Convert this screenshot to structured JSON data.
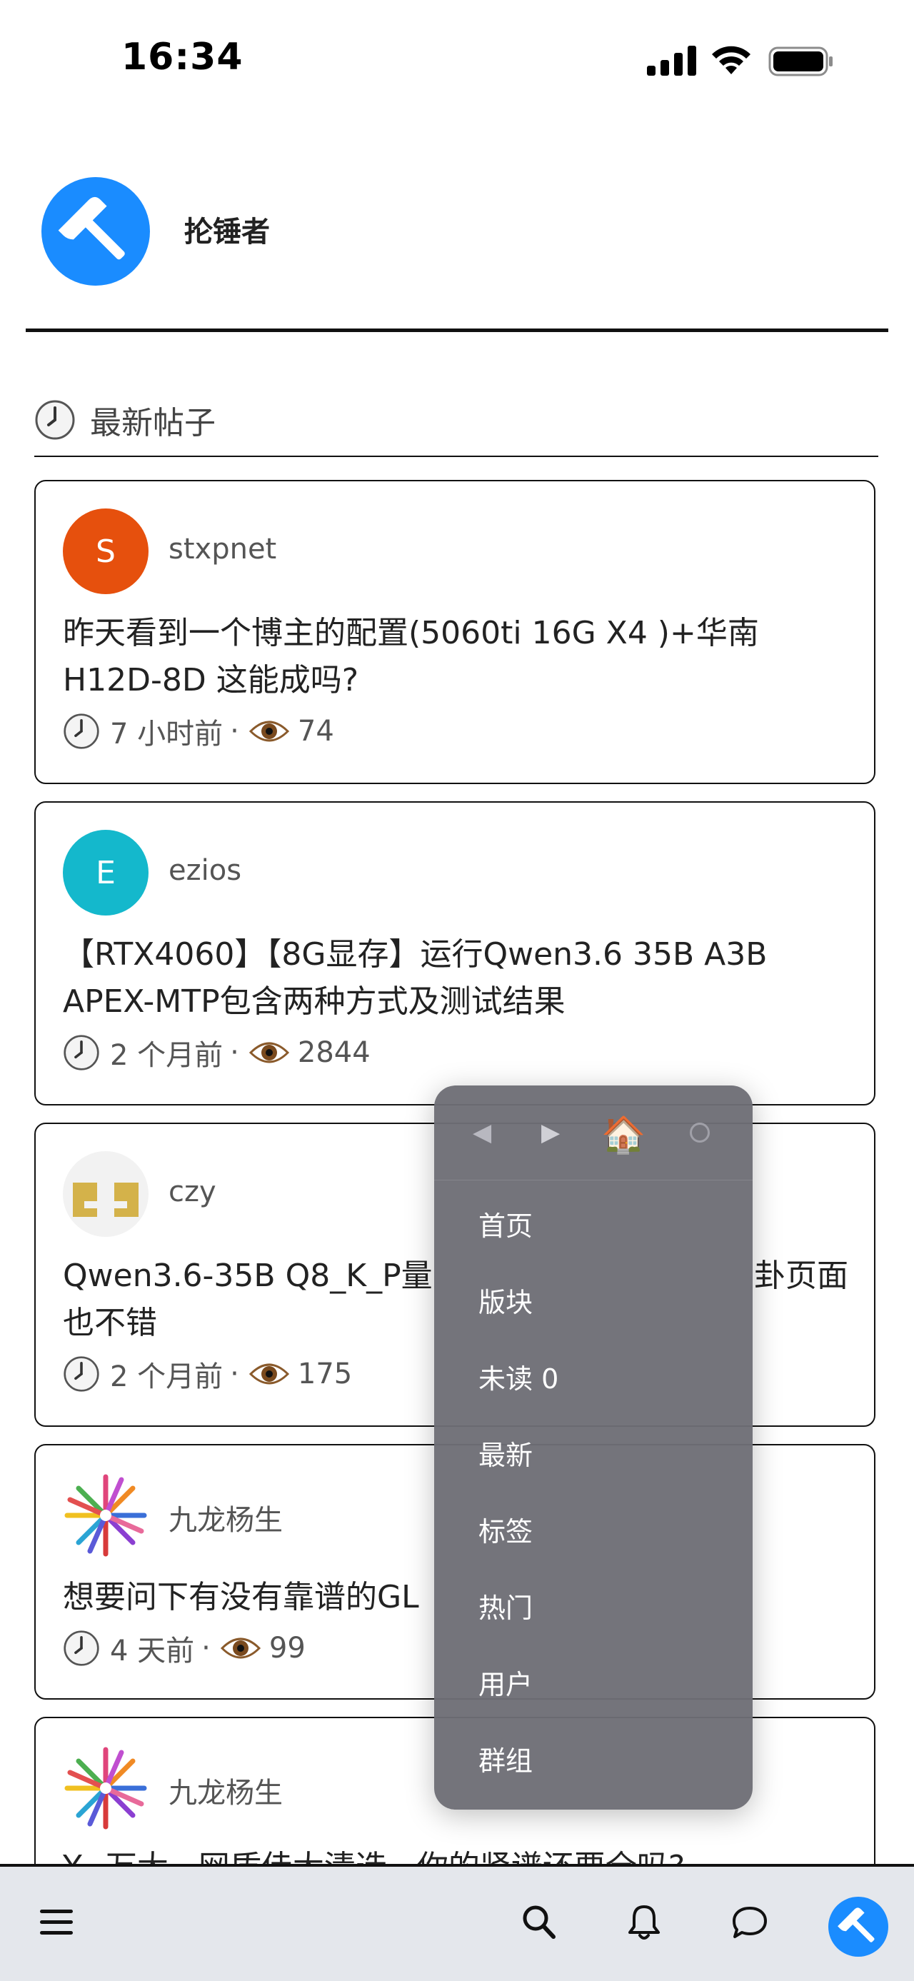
{
  "status_bar": {
    "time": "16:34"
  },
  "header": {
    "site_title": "抡锤者"
  },
  "section": {
    "title": "最新帖子"
  },
  "colors": {
    "brand_blue": "#1a8cff",
    "stxpnet_avatar": "#e6500d",
    "ezios_avatar": "#14b8cc"
  },
  "topics": [
    {
      "username": "stxpnet",
      "avatar_letter": "S",
      "title": "昨天看到一个博主的配置(5060ti 16G X4 )+华南H12D-8D 这能成吗?",
      "age": "7 小时前",
      "views": "74"
    },
    {
      "username": "ezios",
      "avatar_letter": "E",
      "title": "【RTX4060】【8G显存】运行Qwen3.6 35B A3B APEX-MTP包含两种方式及测试结果",
      "age": "2 个月前",
      "views": "2844"
    },
    {
      "username": "czy",
      "title_left": "Qwen3.6-35B Q8_K_P量",
      "title_right": "卦页面",
      "title_line2": "也不错",
      "age": "2 个月前",
      "views": "175"
    },
    {
      "username": "九龙杨生",
      "title_left": "想要问下有没有靠谱的GL",
      "age": "4 天前",
      "views": "99"
    },
    {
      "username": "九龙杨生",
      "title_partial": "Y...万大...网盾佳大清选...你的紧谱还要全吗?"
    }
  ],
  "popup_menu": {
    "nav": {
      "back_icon": "◀",
      "forward_icon": "▶",
      "home_icon": "🏠"
    },
    "items": [
      "首页",
      "版块",
      "未读 0",
      "最新",
      "标签",
      "热门",
      "用户",
      "群组"
    ]
  },
  "meta_separator": "·"
}
